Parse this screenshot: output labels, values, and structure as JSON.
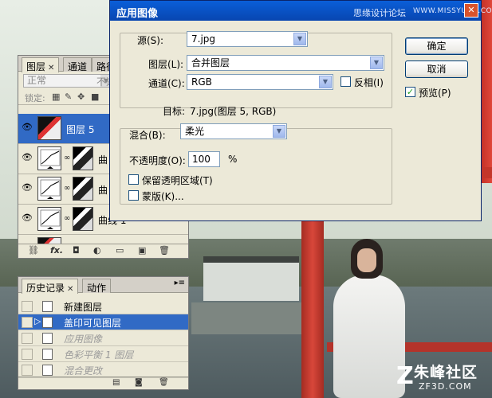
{
  "dialog": {
    "title": "应用图像",
    "title_watermark": "思缘设计论坛",
    "title_watermark_url": "WWW.MISSYUAN.COM",
    "source_label": "源(S):",
    "source_value": "7.jpg",
    "layer_label": "图层(L):",
    "layer_value": "合并图层",
    "channel_label": "通道(C):",
    "channel_value": "RGB",
    "invert_label": "反相(I)",
    "invert_checked": false,
    "target_label": "目标:",
    "target_value": "7.jpg(图层 5, RGB)",
    "blending_label": "混合(B):",
    "blending_value": "柔光",
    "opacity_label": "不透明度(O):",
    "opacity_value": "100",
    "opacity_unit": "%",
    "preserve_transparency_label": "保留透明区域(T)",
    "preserve_transparency_checked": false,
    "mask_label": "蒙版(K)...",
    "mask_checked": false,
    "ok_button": "确定",
    "cancel_button": "取消",
    "preview_label": "预览(P)",
    "preview_checked": true
  },
  "layers_panel": {
    "tabs": [
      {
        "label": "图层"
      },
      {
        "label": "通道"
      },
      {
        "label": "路径"
      }
    ],
    "blend_mode": "正常",
    "opacity_label_partial": "不透",
    "lock_label": "锁定:",
    "layers": [
      {
        "name": "图层 5",
        "type": "photo",
        "selected": true
      },
      {
        "name": "曲",
        "type": "curve",
        "selected": false
      },
      {
        "name": "曲",
        "type": "curve",
        "selected": false
      },
      {
        "name": "曲线 1",
        "type": "curve",
        "selected": false
      }
    ]
  },
  "history_panel": {
    "tabs": [
      {
        "label": "历史记录"
      },
      {
        "label": "动作"
      }
    ],
    "items": [
      {
        "label": "新建图层",
        "state": "active"
      },
      {
        "label": "盖印可见图层",
        "state": "selected"
      },
      {
        "label": "应用图像",
        "state": "dim"
      },
      {
        "label": "色彩平衡 1 图层",
        "state": "dim"
      },
      {
        "label": "混合更改",
        "state": "dim"
      }
    ]
  },
  "watermark": {
    "main": "朱峰社区",
    "sub": "ZF3D.COM"
  }
}
